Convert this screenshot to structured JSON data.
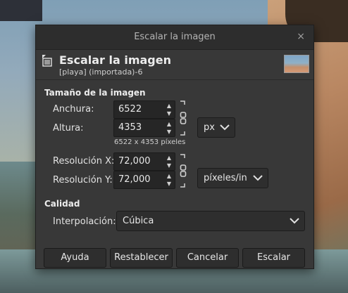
{
  "window": {
    "title": "Escalar la imagen",
    "close_glyph": "×"
  },
  "header": {
    "title": "Escalar la imagen",
    "subtitle": "[playa] (importada)-6",
    "icon": "scale-image-icon",
    "thumbnail": "image-thumbnail"
  },
  "image_size": {
    "section_label": "Tamaño de la imagen",
    "width_label": "Anchura:",
    "width_value": "6522",
    "height_label": "Altura:",
    "height_value": "4353",
    "dimension_note": "6522 x 4353 píxeles",
    "unit": "px",
    "xres_label": "Resolución X:",
    "xres_value": "72,000",
    "yres_label": "Resolución Y:",
    "yres_value": "72,000",
    "res_unit": "píxeles/in"
  },
  "quality": {
    "section_label": "Calidad",
    "interp_label": "Interpolación:",
    "interp_value": "Cúbica"
  },
  "buttons": {
    "help": "Ayuda",
    "reset": "Restablecer",
    "cancel": "Cancelar",
    "scale": "Escalar"
  },
  "colors": {
    "dialog_bg": "#383838",
    "titlebar_bg": "#2d2d2d",
    "field_bg": "#262626"
  }
}
